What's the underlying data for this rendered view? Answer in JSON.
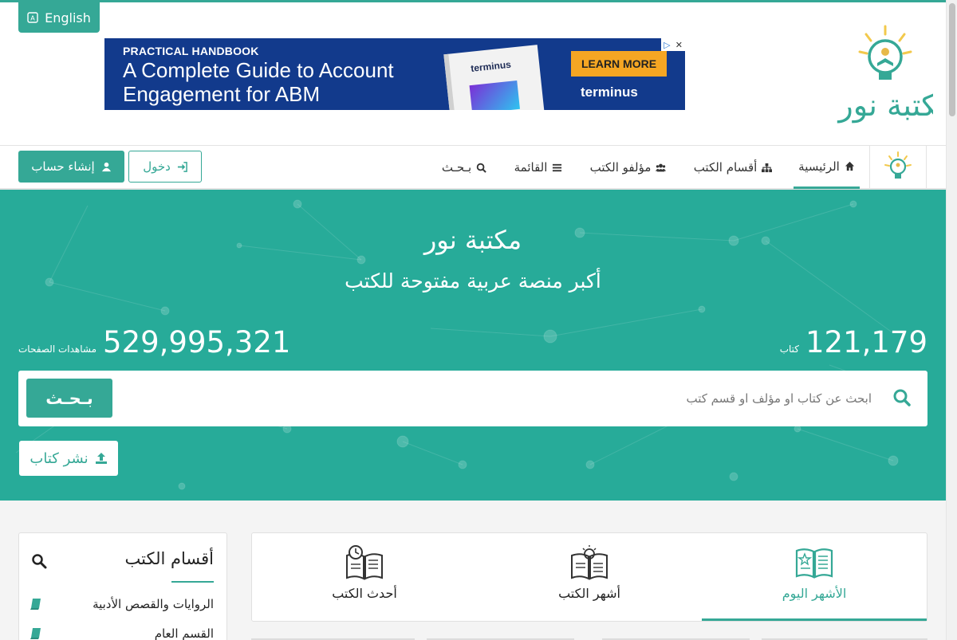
{
  "header": {
    "language_button": "English",
    "ad": {
      "kicker": "PRACTICAL HANDBOOK",
      "headline": "A Complete Guide to Account Engagement for ABM",
      "cta": "LEARN MORE",
      "brand": "terminus",
      "book_brand": "terminus"
    },
    "logo_icon": "lightbulb-reader-logo"
  },
  "nav": {
    "items": [
      {
        "label": "الرئيسية",
        "icon": "home-icon"
      },
      {
        "label": "أقسام الكتب",
        "icon": "sitemap-icon"
      },
      {
        "label": "مؤلفو الكتب",
        "icon": "users-icon"
      },
      {
        "label": "القائمة",
        "icon": "bars-icon"
      },
      {
        "label": "بـحـث",
        "icon": "search-icon"
      }
    ],
    "login": "دخول",
    "register": "إنشاء حساب"
  },
  "hero": {
    "title": "مكتبة نور",
    "subtitle": "أكبر منصة عربية مفتوحة للكتب",
    "books_count": "121,179",
    "books_label": "كتاب",
    "views_count": "529,995,321",
    "views_label": "مشاهدات الصفحات",
    "search_placeholder": "ابحث عن كتاب او مؤلف او قسم كتب",
    "search_button": "بـحـث",
    "publish_button": "نشر كتاب"
  },
  "sections": {
    "title": "أقسام الكتب",
    "items": [
      "الروايات والقصص الأدبية",
      "القسم العام"
    ]
  },
  "tabs": [
    {
      "label": "الأشهر اليوم",
      "icon": "open-book-star-icon",
      "active": true
    },
    {
      "label": "أشهر الكتب",
      "icon": "book-lightbulb-icon",
      "active": false
    },
    {
      "label": "أحدث الكتب",
      "icon": "book-clock-icon",
      "active": false
    }
  ],
  "colors": {
    "accent": "#35a896",
    "hero_bg": "#27ab99",
    "ad_bg": "#123a8c",
    "ad_cta": "#f5a623"
  }
}
